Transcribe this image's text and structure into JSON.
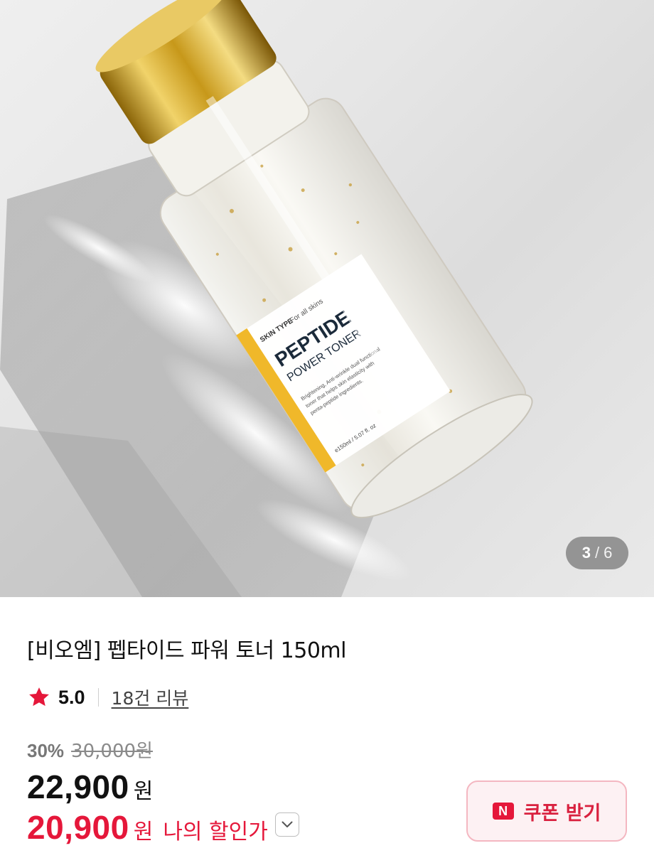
{
  "image": {
    "label_skin_type": "SKIN TYPE",
    "label_for_all_skins": "For all skins",
    "label_brand_line1": "PEPTIDE",
    "label_brand_line2": "POWER TONER",
    "label_desc1": "Brightening, Anti-wrinkle dual functional",
    "label_desc2": "toner that helps skin elasticity with",
    "label_desc3": "penta-peptide ingredients.",
    "label_volume": "e150ml / 5.07 fl. oz",
    "counter_current": "3",
    "counter_separator": "/",
    "counter_total": "6"
  },
  "product": {
    "title": "[비오엠] 펩타이드 파워 토너 150ml",
    "rating": "5.0",
    "review_link": "18건 리뷰",
    "discount_rate": "30%",
    "original_price": "30,000원",
    "price": "22,900",
    "price_unit": "원",
    "my_price": "20,900",
    "my_price_unit": "원",
    "my_price_label": "나의 할인가"
  },
  "coupon": {
    "icon_letter": "N",
    "label": "쿠폰 받기"
  },
  "colors": {
    "accent_red": "#e5173a",
    "coupon_bg": "#fdf1f3",
    "cap_gold": "#c79a1c"
  }
}
